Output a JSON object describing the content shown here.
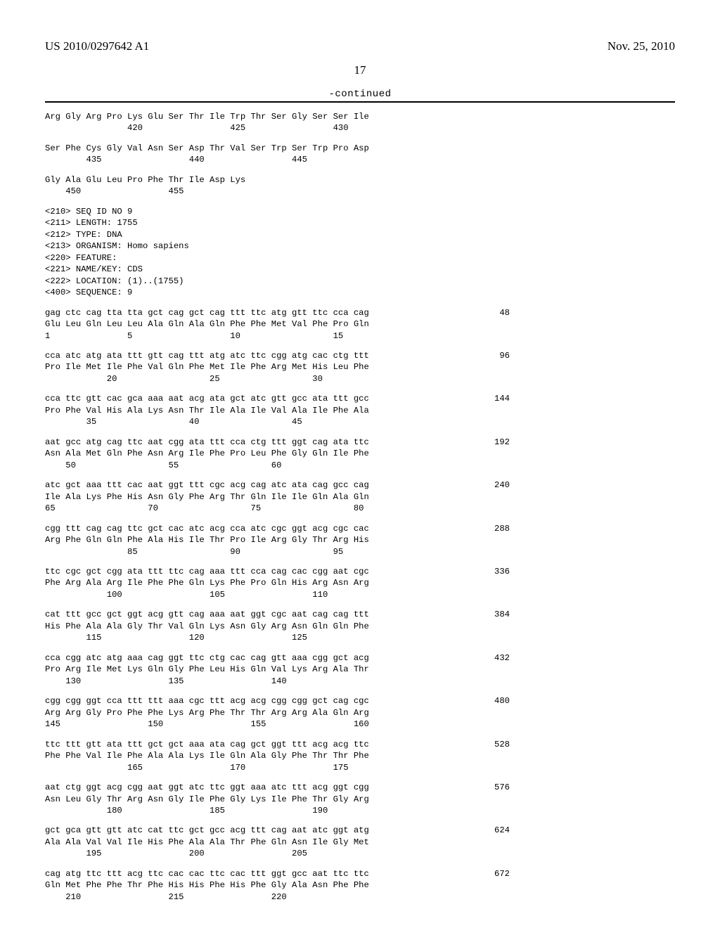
{
  "header": {
    "pub_number": "US 2010/0297642 A1",
    "pub_date": "Nov. 25, 2010",
    "page_number": "17",
    "continued_label": "-continued"
  },
  "tail_protein": {
    "rows": [
      {
        "aa": "Arg Gly Arg Pro Lys Glu Ser Thr Ile Trp Thr Ser Gly Ser Ser Ile",
        "pos": "                420                 425                 430"
      },
      {
        "aa": "Ser Phe Cys Gly Val Asn Ser Asp Thr Val Ser Trp Ser Trp Pro Asp",
        "pos": "        435                 440                 445"
      },
      {
        "aa": "Gly Ala Glu Leu Pro Phe Thr Ile Asp Lys",
        "pos": "    450                 455"
      }
    ]
  },
  "seq_header": {
    "lines": [
      "<210> SEQ ID NO 9",
      "<211> LENGTH: 1755",
      "<212> TYPE: DNA",
      "<213> ORGANISM: Homo sapiens",
      "<220> FEATURE:",
      "<221> NAME/KEY: CDS",
      "<222> LOCATION: (1)..(1755)"
    ],
    "sequence_tag": "<400> SEQUENCE: 9"
  },
  "codon_rows": [
    {
      "nt": "gag ctc cag tta tta gct cag gct cag ttt ttc atg gtt ttc cca cag",
      "idx": "48",
      "aa": "Glu Leu Gln Leu Leu Ala Gln Ala Gln Phe Phe Met Val Phe Pro Gln",
      "pos": "1               5                   10                  15"
    },
    {
      "nt": "cca atc atg ata ttt gtt cag ttt atg atc ttc cgg atg cac ctg ttt",
      "idx": "96",
      "aa": "Pro Ile Met Ile Phe Val Gln Phe Met Ile Phe Arg Met His Leu Phe",
      "pos": "            20                  25                  30"
    },
    {
      "nt": "cca ttc gtt cac gca aaa aat acg ata gct atc gtt gcc ata ttt gcc",
      "idx": "144",
      "aa": "Pro Phe Val His Ala Lys Asn Thr Ile Ala Ile Val Ala Ile Phe Ala",
      "pos": "        35                  40                  45"
    },
    {
      "nt": "aat gcc atg cag ttc aat cgg ata ttt cca ctg ttt ggt cag ata ttc",
      "idx": "192",
      "aa": "Asn Ala Met Gln Phe Asn Arg Ile Phe Pro Leu Phe Gly Gln Ile Phe",
      "pos": "    50                  55                  60"
    },
    {
      "nt": "atc gct aaa ttt cac aat ggt ttt cgc acg cag atc ata cag gcc cag",
      "idx": "240",
      "aa": "Ile Ala Lys Phe His Asn Gly Phe Arg Thr Gln Ile Ile Gln Ala Gln",
      "pos": "65                  70                  75                  80"
    },
    {
      "nt": "cgg ttt cag cag ttc gct cac atc acg cca atc cgc ggt acg cgc cac",
      "idx": "288",
      "aa": "Arg Phe Gln Gln Phe Ala His Ile Thr Pro Ile Arg Gly Thr Arg His",
      "pos": "                85                  90                  95"
    },
    {
      "nt": "ttc cgc gct cgg ata ttt ttc cag aaa ttt cca cag cac cgg aat cgc",
      "idx": "336",
      "aa": "Phe Arg Ala Arg Ile Phe Phe Gln Lys Phe Pro Gln His Arg Asn Arg",
      "pos": "            100                 105                 110"
    },
    {
      "nt": "cat ttt gcc gct ggt acg gtt cag aaa aat ggt cgc aat cag cag ttt",
      "idx": "384",
      "aa": "His Phe Ala Ala Gly Thr Val Gln Lys Asn Gly Arg Asn Gln Gln Phe",
      "pos": "        115                 120                 125"
    },
    {
      "nt": "cca cgg atc atg aaa cag ggt ttc ctg cac cag gtt aaa cgg gct acg",
      "idx": "432",
      "aa": "Pro Arg Ile Met Lys Gln Gly Phe Leu His Gln Val Lys Arg Ala Thr",
      "pos": "    130                 135                 140"
    },
    {
      "nt": "cgg cgg ggt cca ttt ttt aaa cgc ttt acg acg cgg cgg gct cag cgc",
      "idx": "480",
      "aa": "Arg Arg Gly Pro Phe Phe Lys Arg Phe Thr Thr Arg Arg Ala Gln Arg",
      "pos": "145                 150                 155                 160"
    },
    {
      "nt": "ttc ttt gtt ata ttt gct gct aaa ata cag gct ggt ttt acg acg ttc",
      "idx": "528",
      "aa": "Phe Phe Val Ile Phe Ala Ala Lys Ile Gln Ala Gly Phe Thr Thr Phe",
      "pos": "                165                 170                 175"
    },
    {
      "nt": "aat ctg ggt acg cgg aat ggt atc ttc ggt aaa atc ttt acg ggt cgg",
      "idx": "576",
      "aa": "Asn Leu Gly Thr Arg Asn Gly Ile Phe Gly Lys Ile Phe Thr Gly Arg",
      "pos": "            180                 185                 190"
    },
    {
      "nt": "gct gca gtt gtt atc cat ttc gct gcc acg ttt cag aat atc ggt atg",
      "idx": "624",
      "aa": "Ala Ala Val Val Ile His Phe Ala Ala Thr Phe Gln Asn Ile Gly Met",
      "pos": "        195                 200                 205"
    },
    {
      "nt": "cag atg ttc ttt acg ttc cac cac ttc cac ttt ggt gcc aat ttc ttc",
      "idx": "672",
      "aa": "Gln Met Phe Phe Thr Phe His His Phe His Phe Gly Ala Asn Phe Phe",
      "pos": "    210                 215                 220"
    }
  ]
}
